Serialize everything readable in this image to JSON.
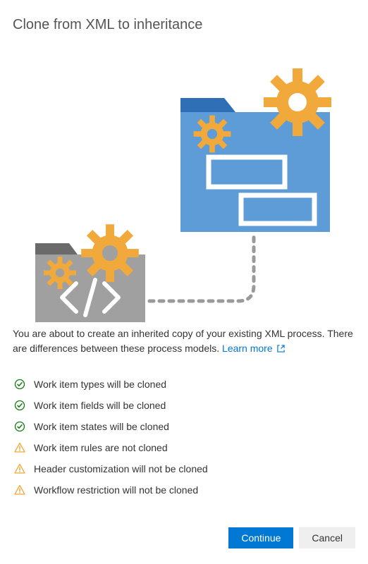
{
  "title": "Clone from XML to inheritance",
  "description_prefix": "You are about to create an inherited copy of your existing XML process. There are differences between these process models. ",
  "learn_more_label": "Learn more",
  "status_items": [
    {
      "type": "success",
      "text": "Work item types will be cloned"
    },
    {
      "type": "success",
      "text": "Work item fields will be cloned"
    },
    {
      "type": "success",
      "text": "Work item states will be cloned"
    },
    {
      "type": "warning",
      "text": "Work item rules are not cloned"
    },
    {
      "type": "warning",
      "text": "Header customization will not be cloned"
    },
    {
      "type": "warning",
      "text": "Workflow restriction will not be cloned"
    }
  ],
  "buttons": {
    "continue": "Continue",
    "cancel": "Cancel"
  },
  "colors": {
    "primary": "#0078d4",
    "success": "#107c10",
    "warning": "#f2a93b"
  }
}
